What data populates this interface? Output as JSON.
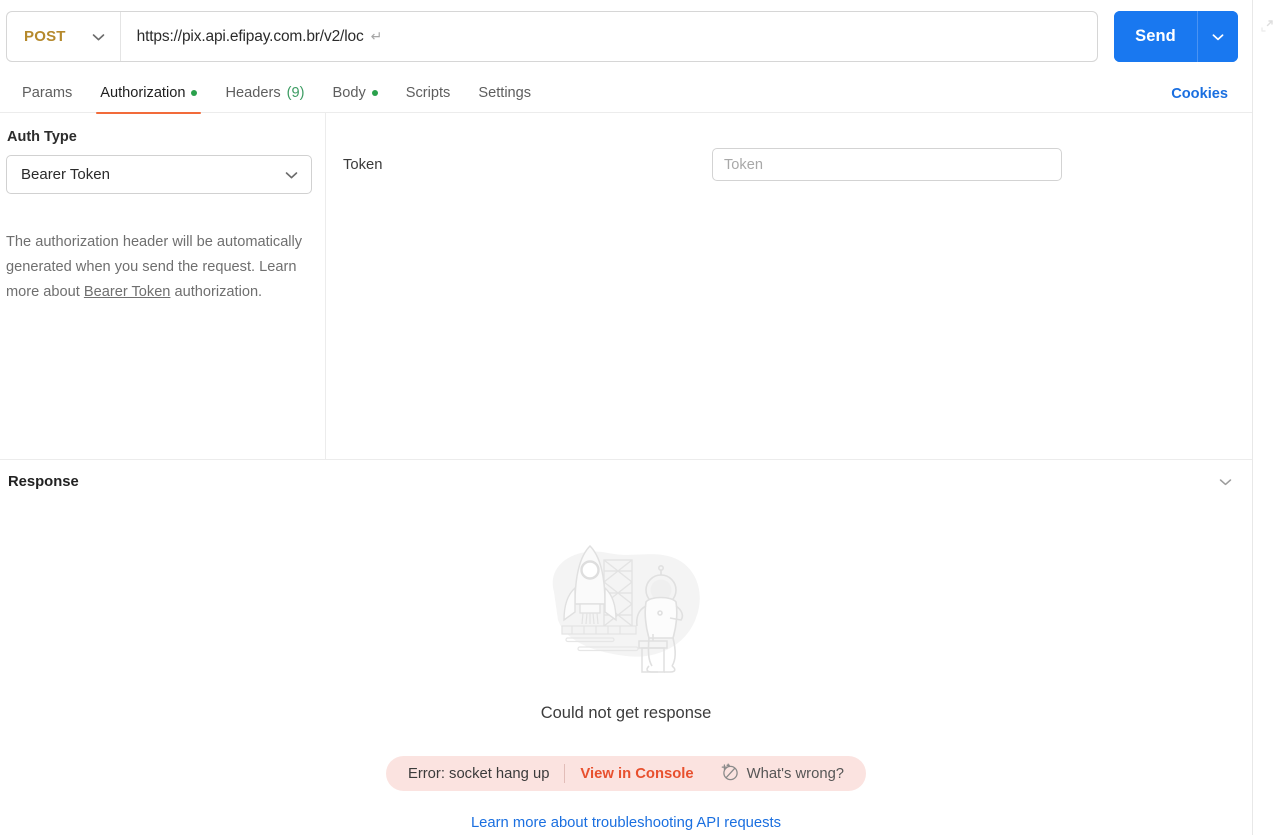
{
  "request": {
    "method": "POST",
    "url": "https://pix.api.efipay.com.br/v2/loc",
    "url_return_glyph": "↵",
    "send_label": "Send"
  },
  "tabs": [
    {
      "label": "Params",
      "active": false,
      "dot": false,
      "count": ""
    },
    {
      "label": "Authorization",
      "active": true,
      "dot": true,
      "count": ""
    },
    {
      "label": "Headers",
      "active": false,
      "dot": false,
      "count": "(9)"
    },
    {
      "label": "Body",
      "active": false,
      "dot": true,
      "count": ""
    },
    {
      "label": "Scripts",
      "active": false,
      "dot": false,
      "count": ""
    },
    {
      "label": "Settings",
      "active": false,
      "dot": false,
      "count": ""
    }
  ],
  "cookies_label": "Cookies",
  "auth": {
    "type_label": "Auth Type",
    "type_value": "Bearer Token",
    "helper_prefix": "The authorization header will be automatically generated when you send the request. Learn more about ",
    "helper_link": "Bearer Token",
    "helper_suffix": " authorization.",
    "token_label": "Token",
    "token_value": "",
    "token_placeholder": "Token"
  },
  "response": {
    "title": "Response",
    "empty_message": "Could not get response",
    "error_text": "Error: socket hang up",
    "console_link": "View in Console",
    "whats_wrong": "What's wrong?",
    "learn_more": "Learn more about troubleshooting API requests"
  },
  "colors": {
    "method_accent": "#b5892c",
    "send_blue": "#1978f0",
    "tab_active_underline": "#f26b3a",
    "status_dot_green": "#2aa14c",
    "error_pill_bg": "#fbe3e0",
    "error_link": "#e8502e",
    "link_blue": "#1a6fe0"
  },
  "icons": {
    "method_chevron": "chevron-down-icon",
    "send_chevron": "chevron-down-icon",
    "select_chevron": "chevron-down-icon",
    "response_collapse": "chevron-down-icon",
    "ai_assist": "sparkle-circle-icon",
    "rail": "expand-diagonal-icon",
    "illustration": "rocket-astronaut-illustration"
  }
}
